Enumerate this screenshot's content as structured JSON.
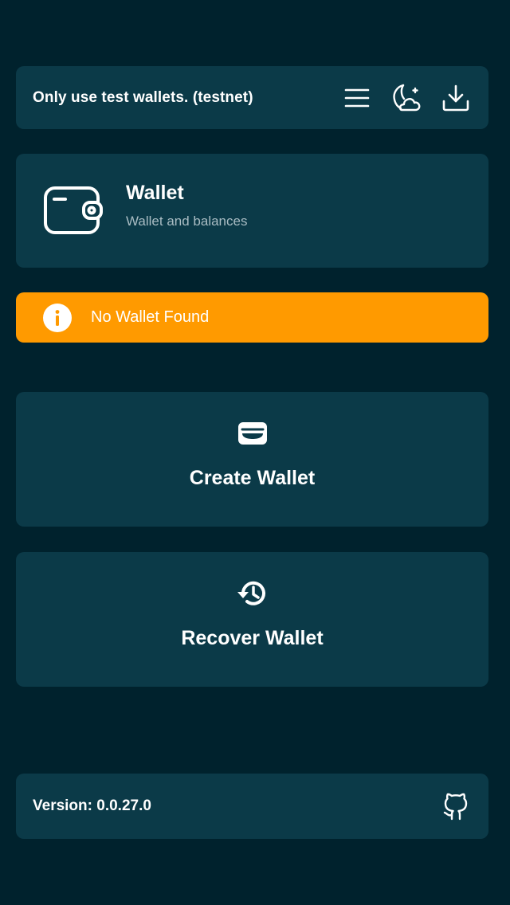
{
  "header": {
    "notice": "Only use test wallets. (testnet)",
    "icons": [
      "menu-icon",
      "theme-toggle-icon",
      "download-icon"
    ]
  },
  "wallet_info": {
    "title": "Wallet",
    "subtitle": "Wallet and balances",
    "icon": "wallet-icon"
  },
  "alert": {
    "message": "No Wallet Found",
    "icon": "info-icon",
    "color": "#ff9a00"
  },
  "actions": [
    {
      "label": "Create Wallet",
      "icon": "card-wallet-icon"
    },
    {
      "label": "Recover Wallet",
      "icon": "restore-history-icon"
    }
  ],
  "footer": {
    "version": "Version: 0.0.27.0",
    "icon": "github-icon"
  },
  "colors": {
    "background": "#00222d",
    "card": "#0b3a48",
    "accent": "#ff9a00",
    "muted_text": "#a9bcc3"
  }
}
